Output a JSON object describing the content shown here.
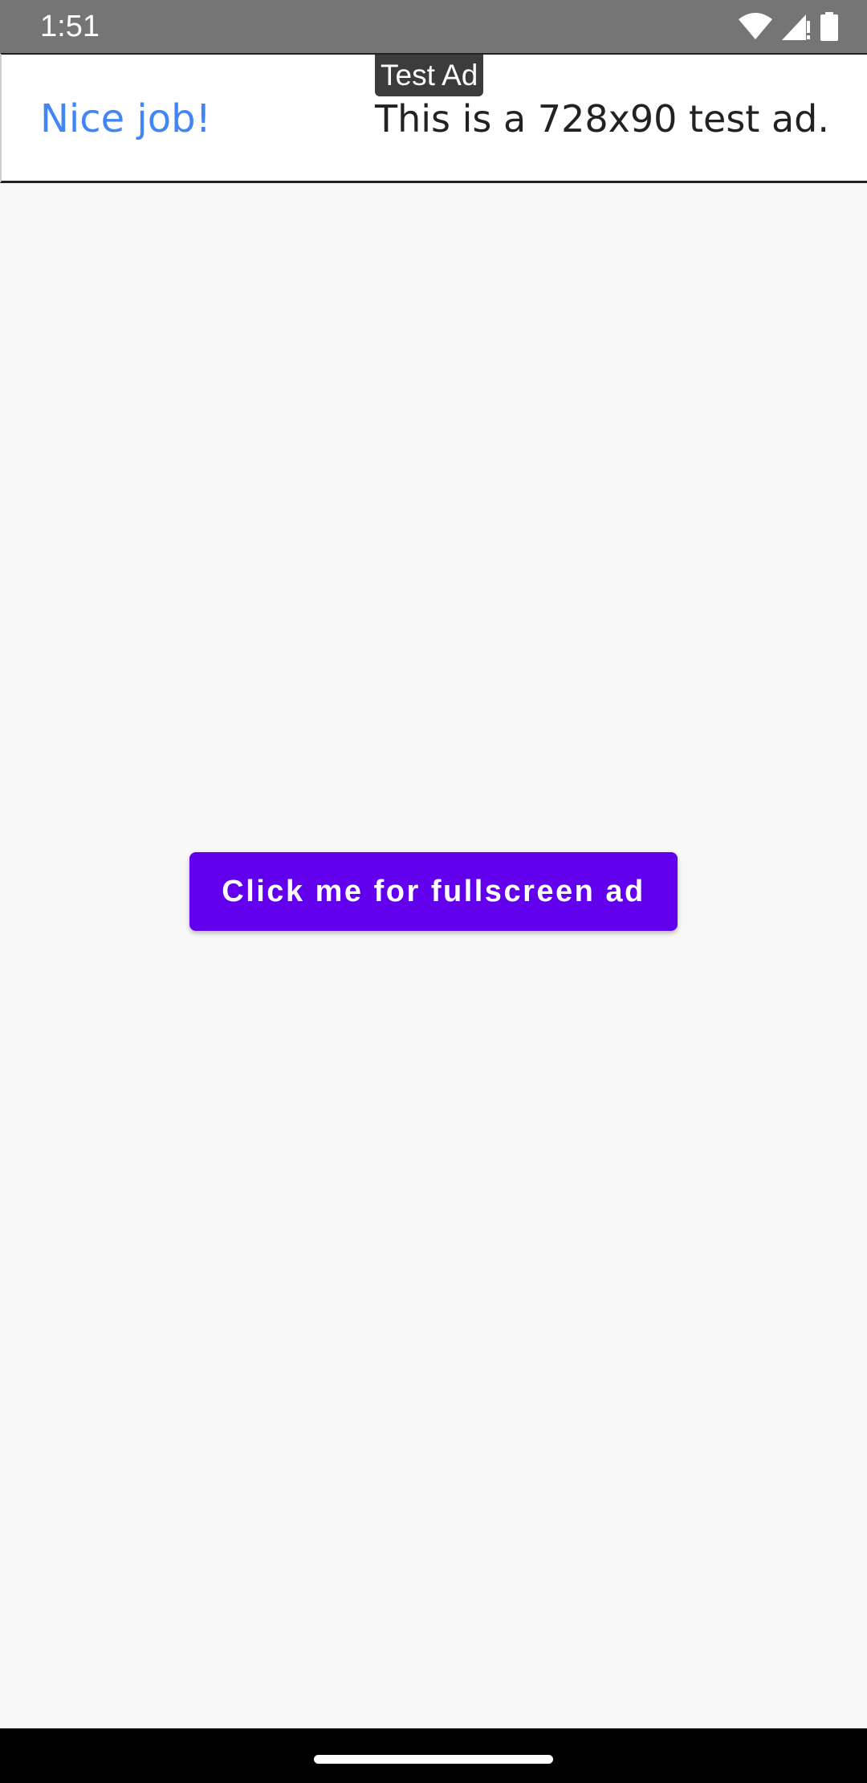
{
  "status_bar": {
    "time": "1:51",
    "icons": [
      "wifi-icon",
      "cell-signal-icon",
      "battery-icon"
    ]
  },
  "ad": {
    "badge": "Test Ad",
    "headline": "Nice job!",
    "body": "This is a 728x90 test ad.",
    "headline_color": "#4285f4"
  },
  "main": {
    "fullscreen_button_label": "Click me for fullscreen ad",
    "button_color": "#6200ee"
  },
  "nav_bar": {
    "home_handle": "home-gesture-handle"
  }
}
